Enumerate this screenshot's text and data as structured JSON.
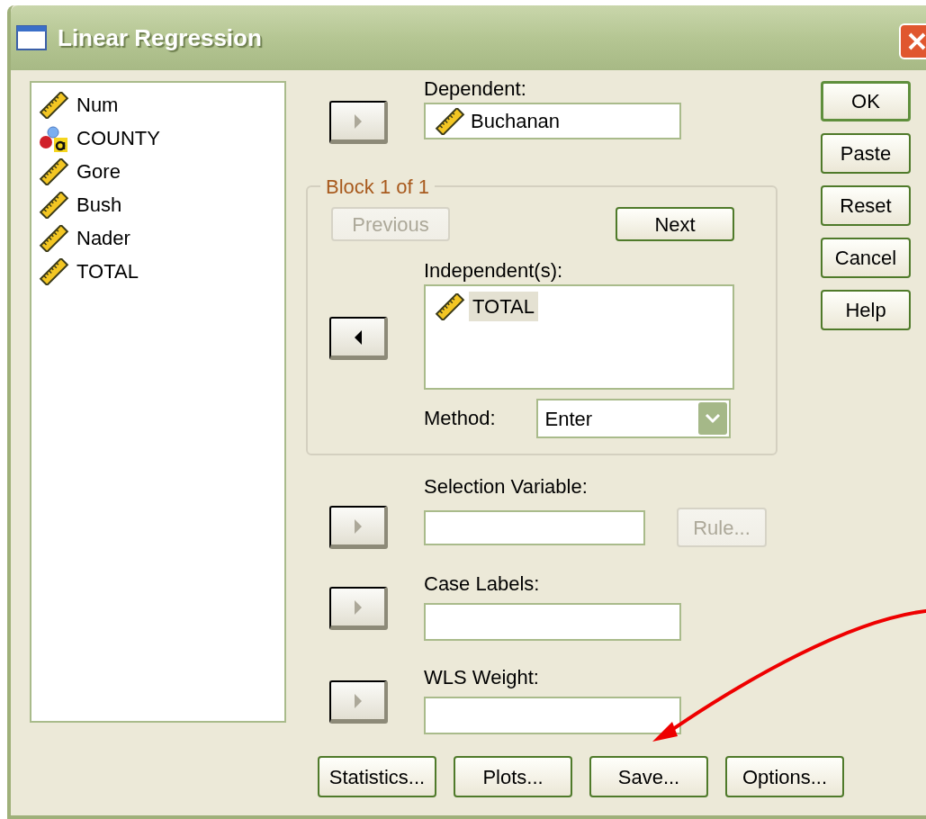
{
  "window": {
    "title": "Linear Regression"
  },
  "variables": [
    {
      "name": "Num",
      "kind": "scale",
      "selected": false
    },
    {
      "name": "COUNTY",
      "kind": "string",
      "selected": false
    },
    {
      "name": "Gore",
      "kind": "scale",
      "selected": false
    },
    {
      "name": "Bush",
      "kind": "scale",
      "selected": false
    },
    {
      "name": "Nader",
      "kind": "scale",
      "selected": false
    },
    {
      "name": "TOTAL",
      "kind": "scale",
      "selected": false
    }
  ],
  "dependent": {
    "label": "Dependent:",
    "arrow": {
      "kind": "right",
      "disabled": true
    },
    "value": {
      "name": "Buchanan",
      "kind": "scale"
    }
  },
  "block": {
    "title": "Block 1 of 1",
    "buttons": [
      {
        "label": "Previous",
        "disabled": true
      },
      {
        "label": "Next",
        "disabled": false
      }
    ],
    "independents": {
      "label": "Independent(s):",
      "arrow": {
        "kind": "left",
        "disabled": false
      },
      "items": [
        {
          "name": "TOTAL",
          "kind": "scale",
          "selected": true
        }
      ]
    },
    "method": {
      "label": "Method:",
      "value": "Enter"
    }
  },
  "selection_variable": {
    "label": "Selection Variable:",
    "arrow": {
      "kind": "right",
      "disabled": true
    },
    "rule_button": {
      "label": "Rule...",
      "disabled": true
    }
  },
  "case_labels": {
    "label": "Case Labels:",
    "arrow": {
      "kind": "right",
      "disabled": true
    }
  },
  "wls_weight": {
    "label": "WLS Weight:",
    "arrow": {
      "kind": "right",
      "disabled": true
    }
  },
  "bottom_buttons": [
    {
      "label": "Statistics..."
    },
    {
      "label": "Plots..."
    },
    {
      "label": "Save..."
    },
    {
      "label": "Options..."
    }
  ],
  "side_buttons": [
    {
      "label": "OK",
      "default": true
    },
    {
      "label": "Paste",
      "default": false
    },
    {
      "label": "Reset",
      "default": false
    },
    {
      "label": "Cancel",
      "default": false
    },
    {
      "label": "Help",
      "default": false
    }
  ]
}
